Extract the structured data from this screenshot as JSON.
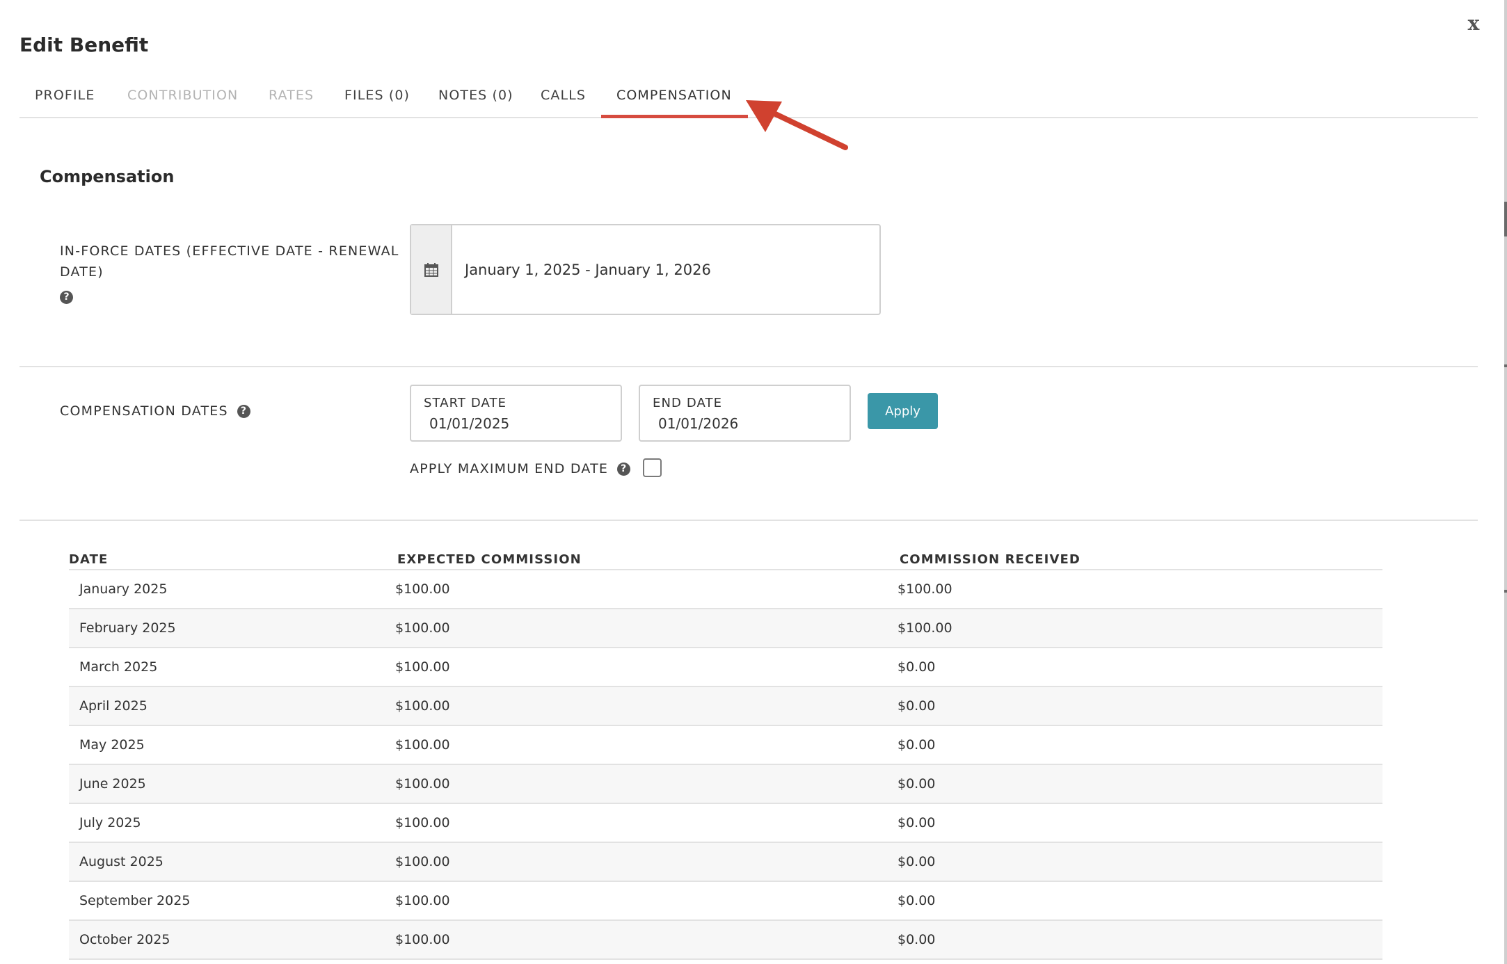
{
  "modal": {
    "title": "Edit Benefit",
    "close_label": "x"
  },
  "tabs": [
    {
      "label": "PROFILE",
      "state": "normal"
    },
    {
      "label": "CONTRIBUTION",
      "state": "disabled"
    },
    {
      "label": "RATES",
      "state": "disabled"
    },
    {
      "label": "FILES (0)",
      "state": "normal"
    },
    {
      "label": "NOTES (0)",
      "state": "normal"
    },
    {
      "label": "CALLS",
      "state": "normal"
    },
    {
      "label": "COMPENSATION",
      "state": "active"
    }
  ],
  "section": {
    "title": "Compensation"
  },
  "inforce": {
    "label": "IN-FORCE DATES (EFFECTIVE DATE - RENEWAL DATE)",
    "value": "January 1, 2025 - January 1, 2026",
    "icon": "calendar-icon"
  },
  "compensation_dates": {
    "label": "COMPENSATION DATES",
    "start_label": "START DATE",
    "start_value": "01/01/2025",
    "end_label": "END DATE",
    "end_value": "01/01/2026",
    "apply_label": "Apply",
    "max_end_label": "APPLY MAXIMUM END DATE",
    "max_end_checked": false
  },
  "table": {
    "headers": [
      "DATE",
      "EXPECTED COMMISSION",
      "COMMISSION RECEIVED"
    ],
    "rows": [
      [
        "January 2025",
        "$100.00",
        "$100.00"
      ],
      [
        "February 2025",
        "$100.00",
        "$100.00"
      ],
      [
        "March 2025",
        "$100.00",
        "$0.00"
      ],
      [
        "April 2025",
        "$100.00",
        "$0.00"
      ],
      [
        "May 2025",
        "$100.00",
        "$0.00"
      ],
      [
        "June 2025",
        "$100.00",
        "$0.00"
      ],
      [
        "July 2025",
        "$100.00",
        "$0.00"
      ],
      [
        "August 2025",
        "$100.00",
        "$0.00"
      ],
      [
        "September 2025",
        "$100.00",
        "$0.00"
      ],
      [
        "October 2025",
        "$100.00",
        "$0.00"
      ]
    ]
  },
  "colors": {
    "accent_underline": "#d64b3f",
    "annotation_arrow": "#d0412f",
    "apply_button": "#3a97a8",
    "row_alt": "#f7f7f7"
  }
}
